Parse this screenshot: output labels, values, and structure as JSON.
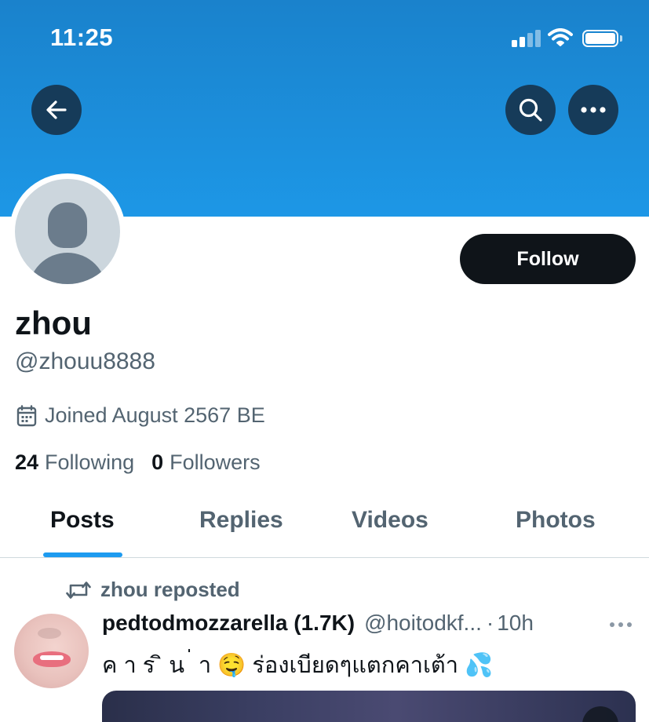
{
  "status_bar": {
    "time": "11:25"
  },
  "colors": {
    "banner": "#1d97e6",
    "accent": "#1d9bf0",
    "muted": "#536471",
    "text": "#0f1419"
  },
  "header": {
    "back_icon": "arrow-left-icon",
    "search_icon": "search-icon",
    "more_icon": "more-horizontal-icon"
  },
  "profile": {
    "display_name": "zhou",
    "handle": "@zhouu8888",
    "joined": "Joined August 2567 BE",
    "follow_label": "Follow",
    "following_count": "24",
    "following_label": "Following",
    "followers_count": "0",
    "followers_label": "Followers"
  },
  "tabs": [
    {
      "label": "Posts",
      "active": true
    },
    {
      "label": "Replies",
      "active": false
    },
    {
      "label": "Videos",
      "active": false
    },
    {
      "label": "Photos",
      "active": false
    }
  ],
  "feed": {
    "repost_label": "zhou reposted",
    "post": {
      "author": "pedtodmozzarella (1.7K)",
      "handle": "@hoitodkf...",
      "separator": "·",
      "time": "10h",
      "text": "ค า ร ิ น ่ า 🤤 ร่องเบียดๆแตกคาเต้า 💦"
    }
  }
}
